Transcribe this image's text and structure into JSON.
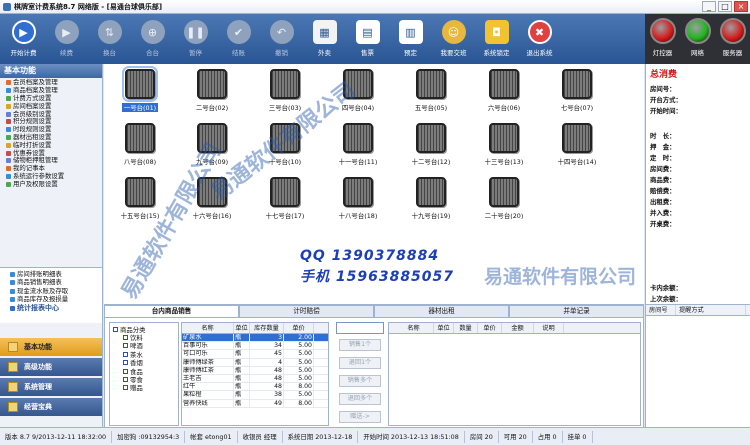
{
  "window": {
    "title": "棋牌室计费系统8.7 网络版 - [易通台球俱乐部]",
    "minimize": "_",
    "maximize": "□",
    "close": "×"
  },
  "toolbar": [
    {
      "label": "开始计费",
      "icon": "play-icon",
      "enabled": true
    },
    {
      "label": "续费",
      "icon": "play-icon",
      "enabled": false
    },
    {
      "label": "换台",
      "icon": "swap-icon",
      "enabled": false
    },
    {
      "label": "合台",
      "icon": "merge-icon",
      "enabled": false
    },
    {
      "label": "暂停",
      "icon": "pause-icon",
      "enabled": false
    },
    {
      "label": "结账",
      "icon": "check-icon",
      "enabled": false
    },
    {
      "label": "撤销",
      "icon": "undo-icon",
      "enabled": false
    },
    {
      "label": "外卖",
      "icon": "cart-icon",
      "enabled": true
    },
    {
      "label": "售票",
      "icon": "ticket-icon",
      "enabled": true
    },
    {
      "label": "预定",
      "icon": "book-icon",
      "enabled": true
    },
    {
      "label": "我要交班",
      "icon": "person-icon",
      "enabled": true
    },
    {
      "label": "系统锁定",
      "icon": "lock-icon",
      "enabled": true
    },
    {
      "label": "退出系统",
      "icon": "exit-icon",
      "enabled": true
    }
  ],
  "signals": [
    {
      "label": "灯控器",
      "color": "#d41d1d"
    },
    {
      "label": "网络",
      "color": "#1fb51f"
    },
    {
      "label": "服务器",
      "color": "#d41d1d"
    }
  ],
  "left_nav": {
    "header": "基本功能",
    "items": [
      "会员档案及管理",
      "商品档案及管理",
      "计费方式设置",
      "房间档案设置",
      "会员级别设置",
      "积分规则设置",
      "时段规则设置",
      "器材出租设置",
      "临时打折设置",
      "优惠券设置",
      "储物柜押租管理",
      "我的记事本",
      "系统运行参数设置",
      "用户及权限设置"
    ]
  },
  "reports": {
    "items": [
      "房间排账明细表",
      "商品销售明细表",
      "现金流水账及存取",
      "商品库存及报损量"
    ],
    "stat_center": "统计报表中心"
  },
  "modules": [
    "基本功能",
    "高级功能",
    "系统管理",
    "经营宝典"
  ],
  "tables": [
    "一号台(01)",
    "二号台(02)",
    "三号台(03)",
    "四号台(04)",
    "五号台(05)",
    "六号台(06)",
    "七号台(07)",
    "八号台(08)",
    "九号台(09)",
    "十号台(10)",
    "十一号台(11)",
    "十二号台(12)",
    "十三号台(13)",
    "十四号台(14)",
    "十五号台(15)",
    "十六号台(16)",
    "十七号台(17)",
    "十八号台(18)",
    "十九号台(19)",
    "二十号台(20)"
  ],
  "contact": {
    "qq": "QQ 1390378884",
    "phone": "手机 15963885057"
  },
  "watermarks": [
    "易通软件有限公司",
    "易通软件有限公司",
    "易通软件有限公司"
  ],
  "info_panel": {
    "title": "总消费",
    "fields": [
      "房间号：",
      "开台方式：",
      "开始时间："
    ],
    "fields2": [
      "时　长：",
      "押　金：",
      "定　时：",
      "房间费：",
      "商品费：",
      "赔偿费：",
      "出租费：",
      "并入费：",
      "开桌费："
    ],
    "bottom_fields": [
      "卡内余额：",
      "上次余额："
    ]
  },
  "bottom_tabs": [
    "台内商品销售",
    "计时赔偿",
    "器材出租",
    "并单记录"
  ],
  "tree": {
    "root": "商品分类",
    "children": [
      "饮料",
      "啤酒",
      "茶水",
      "香烟",
      "食品",
      "零食",
      "赠品"
    ]
  },
  "product_table": {
    "headers": [
      "名称",
      "单位",
      "库存数量",
      "单价"
    ],
    "rows": [
      [
        "矿泉水",
        "瓶",
        "3",
        "2.00"
      ],
      [
        "百事可乐",
        "瓶",
        "34",
        "5.00"
      ],
      [
        "可口可乐",
        "瓶",
        "45",
        "5.00"
      ],
      [
        "康师傅绿茶",
        "瓶",
        "4",
        "5.00"
      ],
      [
        "康师傅红茶",
        "瓶",
        "48",
        "5.00"
      ],
      [
        "王老吉",
        "瓶",
        "48",
        "5.00"
      ],
      [
        "红牛",
        "瓶",
        "48",
        "8.00"
      ],
      [
        "果粒橙",
        "瓶",
        "38",
        "5.00"
      ],
      [
        "营养快线",
        "瓶",
        "49",
        "8.00"
      ]
    ]
  },
  "ops": [
    "销售1个",
    "退回1个",
    "销售多个",
    "退回多个",
    "赠送->"
  ],
  "cart_table": {
    "headers": [
      "名称",
      "单位",
      "数量",
      "单价",
      "金额",
      "说明"
    ]
  },
  "reservation": {
    "headers": [
      "房间号",
      "提醒方式"
    ]
  },
  "status_bar": [
    "版本 8.7 9/2013-12-11 18:32:00",
    "加密狗 :09132954:3",
    "帐套 etong01",
    "收银员 经理",
    "系统日期 2013-12-18",
    "开始时间 2013-12-13 18:51:08",
    "房间 20",
    "可用 20",
    "占用 0",
    "挂单 0"
  ]
}
